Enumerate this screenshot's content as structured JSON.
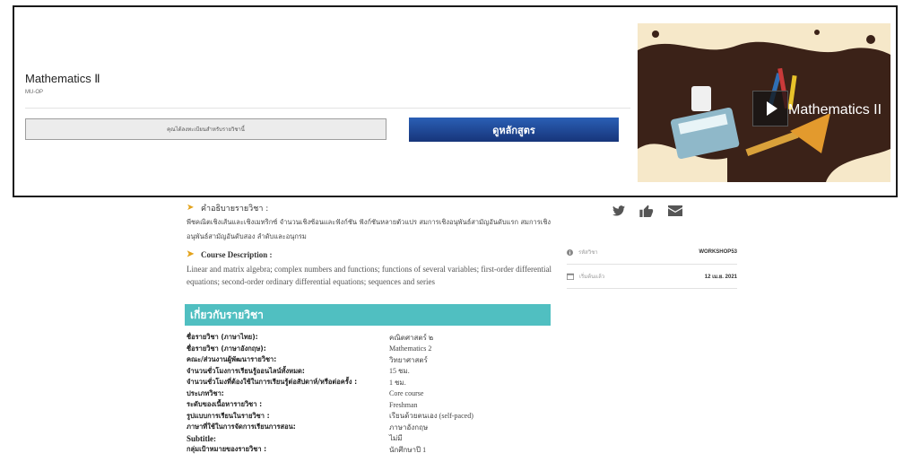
{
  "course": {
    "title": "Mathematics Ⅱ",
    "code": "MU-OP",
    "enroll_label": "คุณได้ลงทะเบียนสำหรับรายวิชานี้",
    "syllabus_label": "ดูหลักสูตร",
    "thumbnail_title": "Mathematics II"
  },
  "description": {
    "th_heading": "คำอธิบายรายวิชา :",
    "th_text": "พีชคณิตเชิงเส้นและเชิงเมทริกซ์ จำนวนเชิงซ้อนและฟังก์ชัน ฟังก์ชันหลายตัวแปร สมการเชิงอนุพันธ์สามัญอันดับแรก สมการเชิงอนุพันธ์สามัญอันดับสอง ลำดับและอนุกรม",
    "en_heading": "Course Description :",
    "en_text": "Linear and matrix algebra; complex numbers and functions; functions of several variables; first-order differential equations; second-order ordinary differential equations; sequences and series"
  },
  "about": {
    "heading": "เกี่ยวกับรายวิชา",
    "rows": [
      {
        "label": "ชื่อรายวิชา (ภาษาไทย):",
        "value": "คณิตศาสตร์ ๒"
      },
      {
        "label": "ชื่อรายวิชา (ภาษาอังกฤษ):",
        "value": "Mathematics 2"
      },
      {
        "label": "คณะ/ส่วนงานผู้พัฒนารายวิชา:",
        "value": "วิทยาศาสตร์"
      },
      {
        "label": "จำนวนชั่วโมงการเรียนรู้ออนไลน์ทั้งหมด:",
        "value": "15 ชม."
      },
      {
        "label": "จำนวนชั่วโมงที่ต้องใช้ในการเรียนรู้ต่อสัปดาห์/หรือต่อครั้ง :",
        "value": "1 ชม."
      },
      {
        "label": "ประเภทวิชา:",
        "value": "Core course"
      },
      {
        "label": "ระดับของเนื้อหารายวิชา :",
        "value": "Freshman"
      },
      {
        "label": "รูปแบบการเรียนในรายวิชา :",
        "value": "เรียนด้วยตนเอง (self-paced)"
      },
      {
        "label": "ภาษาที่ใช้ในการจัดการเรียนการสอน:",
        "value": "ภาษาอังกฤษ"
      },
      {
        "label": "Subtitle:",
        "value": "ไม่มี",
        "en": true
      },
      {
        "label": "กลุ่มเป้าหมายของรายวิชา :",
        "value": "นักศึกษาปี 1"
      }
    ]
  },
  "sidebar": {
    "code_label": "รหัสวิชา",
    "code_value": "WORKSHOP53",
    "start_label": "เริ่มต้นแล้ว",
    "start_value": "12 เม.ย. 2021"
  },
  "colors": {
    "primary_button": "#1f4a99",
    "about_bar": "#50bfc1"
  }
}
